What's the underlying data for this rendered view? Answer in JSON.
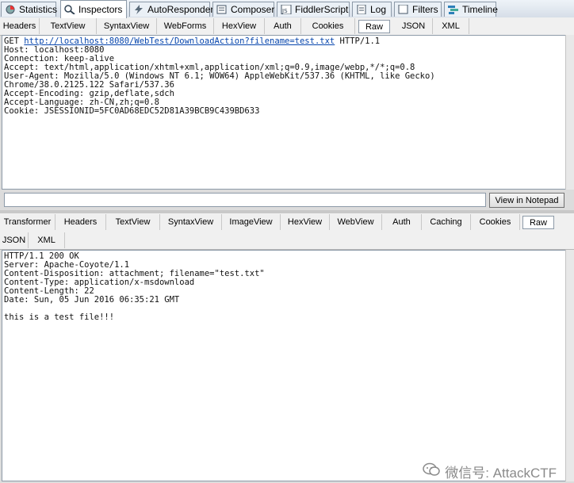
{
  "top_tabs": [
    {
      "label": "Statistics",
      "icon": "statistics-icon"
    },
    {
      "label": "Inspectors",
      "icon": "inspectors-icon"
    },
    {
      "label": "AutoResponder",
      "icon": "autoresponder-icon"
    },
    {
      "label": "Composer",
      "icon": "composer-icon"
    },
    {
      "label": "FiddlerScript",
      "icon": "fiddlerscript-icon"
    },
    {
      "label": "Log",
      "icon": "log-icon"
    },
    {
      "label": "Filters",
      "icon": "filters-checkbox-icon"
    },
    {
      "label": "Timeline",
      "icon": "timeline-icon"
    }
  ],
  "request_tabs": [
    "Headers",
    "TextView",
    "SyntaxView",
    "WebForms",
    "HexView",
    "Auth",
    "Cookies",
    "Raw",
    "JSON",
    "XML"
  ],
  "request": {
    "line1_method": "GET ",
    "line1_url": "http://localhost:8080/WebTest/DownloadAction?filename=test.txt",
    "line1_proto": " HTTP/1.1",
    "rest": "Host: localhost:8080\nConnection: keep-alive\nAccept: text/html,application/xhtml+xml,application/xml;q=0.9,image/webp,*/*;q=0.8\nUser-Agent: Mozilla/5.0 (Windows NT 6.1; WOW64) AppleWebKit/537.36 (KHTML, like Gecko)\nChrome/38.0.2125.122 Safari/537.36\nAccept-Encoding: gzip,deflate,sdch\nAccept-Language: zh-CN,zh;q=0.8\nCookie: JSESSIONID=5FC0AD68EDC52D81A39BCB9C439BD633"
  },
  "notepad_input_value": "",
  "view_in_notepad_label": "View in Notepad",
  "response_tabs_row1": [
    "Transformer",
    "Headers",
    "TextView",
    "SyntaxView",
    "ImageView",
    "HexView",
    "WebView",
    "Auth",
    "Caching",
    "Cookies",
    "Raw"
  ],
  "response_tabs_row2": [
    "JSON",
    "XML"
  ],
  "response": {
    "text": "HTTP/1.1 200 OK\nServer: Apache-Coyote/1.1\nContent-Disposition: attachment; filename=\"test.txt\"\nContent-Type: application/x-msdownload\nContent-Length: 22\nDate: Sun, 05 Jun 2016 06:35:21 GMT\n\nthis is a test file!!!"
  },
  "watermark": "微信号: AttackCTF",
  "colors": {
    "active_tab_bg": "#ffffff",
    "tab_border": "#8d9aa8",
    "link": "#0645ad"
  }
}
